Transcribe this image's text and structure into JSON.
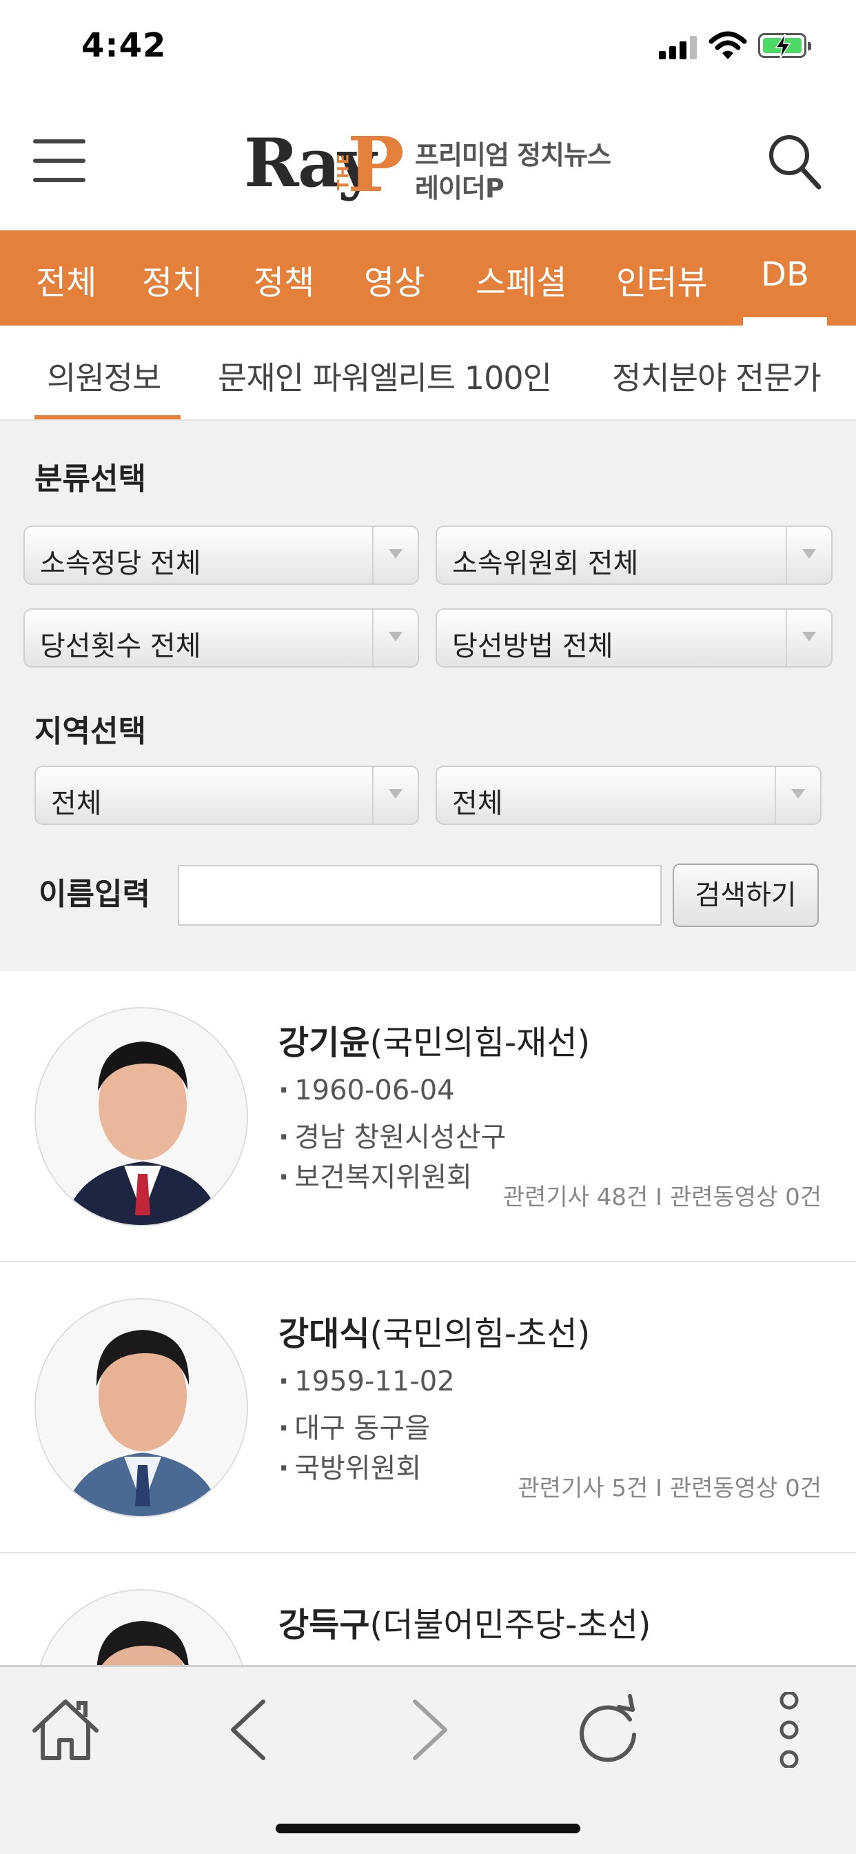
{
  "status_bar": {
    "time": "4:42"
  },
  "header": {
    "logo_main": "Ray",
    "logo_p": "P",
    "logo_the": "THE",
    "tagline_1": "프리미엄 정치뉴스",
    "tagline_2": "레이더P"
  },
  "main_nav": [
    {
      "label": "전체"
    },
    {
      "label": "정치"
    },
    {
      "label": "정책"
    },
    {
      "label": "영상"
    },
    {
      "label": "스페셜"
    },
    {
      "label": "인터뷰"
    },
    {
      "label": "DB",
      "active": true
    }
  ],
  "sub_tabs": [
    {
      "label": "의원정보",
      "active": true
    },
    {
      "label": "문재인 파워엘리트 100인"
    },
    {
      "label": "정치분야 전문가"
    }
  ],
  "filters": {
    "category_title": "분류선택",
    "party": "소속정당 전체",
    "committee": "소속위원회 전체",
    "terms": "당선횟수 전체",
    "method": "당선방법 전체",
    "region_title": "지역선택",
    "region_1": "전체",
    "region_2": "전체",
    "name_label": "이름입력",
    "name_value": "",
    "search_button": "검색하기"
  },
  "members": [
    {
      "name": "강기윤",
      "affiliation": "(국민의힘-재선)",
      "birth": "1960-06-04",
      "district": "경남 창원시성산구",
      "committee": "보건복지위원회",
      "stats": "관련기사 48건 I 관련동영상 0건"
    },
    {
      "name": "강대식",
      "affiliation": "(국민의힘-초선)",
      "birth": "1959-11-02",
      "district": "대구 동구을",
      "committee": "국방위원회",
      "stats": "관련기사 5건 I 관련동영상 0건"
    },
    {
      "name": "강득구",
      "affiliation": "(더불어민주당-초선)"
    }
  ],
  "colors": {
    "accent": "#e5803a",
    "filter_bg": "#f1f1f1",
    "battery_green": "#4cd964"
  },
  "icons": {
    "menu": "hamburger-icon",
    "search": "search-icon",
    "home": "home-icon",
    "back": "chevron-left-icon",
    "forward": "chevron-right-icon",
    "reload": "reload-icon",
    "more": "more-vertical-icon"
  }
}
